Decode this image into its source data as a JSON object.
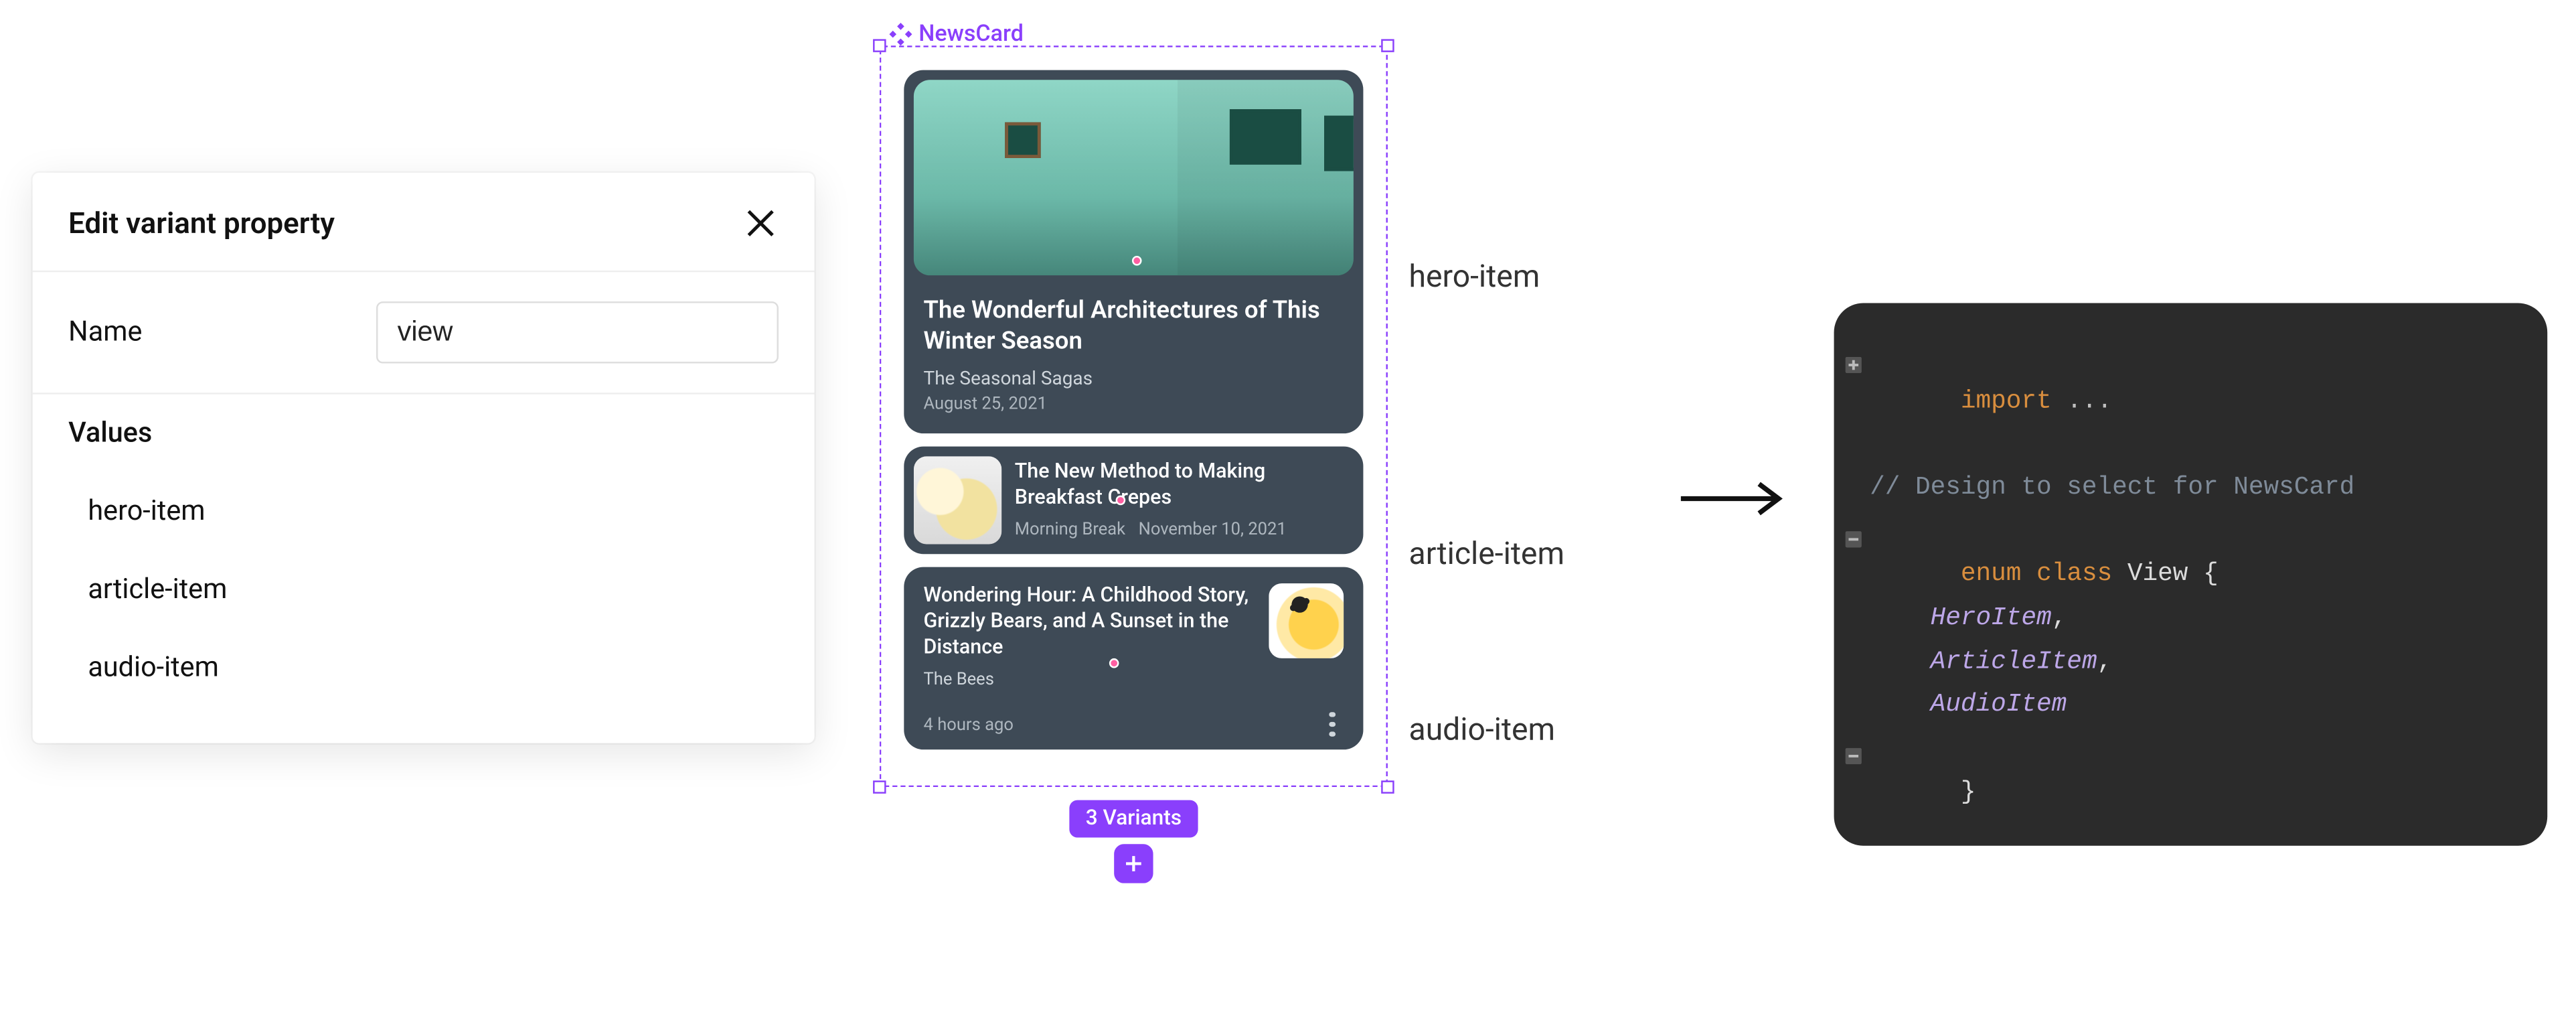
{
  "panel": {
    "title": "Edit variant property",
    "name_label": "Name",
    "name_value": "view",
    "values_label": "Values",
    "values": [
      "hero-item",
      "article-item",
      "audio-item"
    ]
  },
  "component": {
    "name": "NewsCard",
    "badge": "3 Variants",
    "variant_labels": [
      "hero-item",
      "article-item",
      "audio-item"
    ]
  },
  "cards": {
    "hero": {
      "title": "The Wonderful Architectures of This Winter Season",
      "subtitle": "The Seasonal Sagas",
      "date": "August 25, 2021"
    },
    "article": {
      "title": "The New Method to Making Breakfast Crepes",
      "source": "Morning Break",
      "date": "November 10, 2021"
    },
    "audio": {
      "title": "Wondering Hour: A Childhood Story, Grizzly Bears, and A Sunset in the Distance",
      "source": "The Bees",
      "time": "4 hours ago"
    }
  },
  "code": {
    "l1_kw": "import",
    "l1_rest": " ...",
    "l2": "// Design to select for NewsCard",
    "l3_kw1": "enum",
    "l3_kw2": "class",
    "l3_name": "View",
    "l3_brace": " {",
    "l4": "HeroItem",
    "l5": "ArticleItem",
    "l6": "AudioItem",
    "l7": "}",
    "comma": ","
  }
}
